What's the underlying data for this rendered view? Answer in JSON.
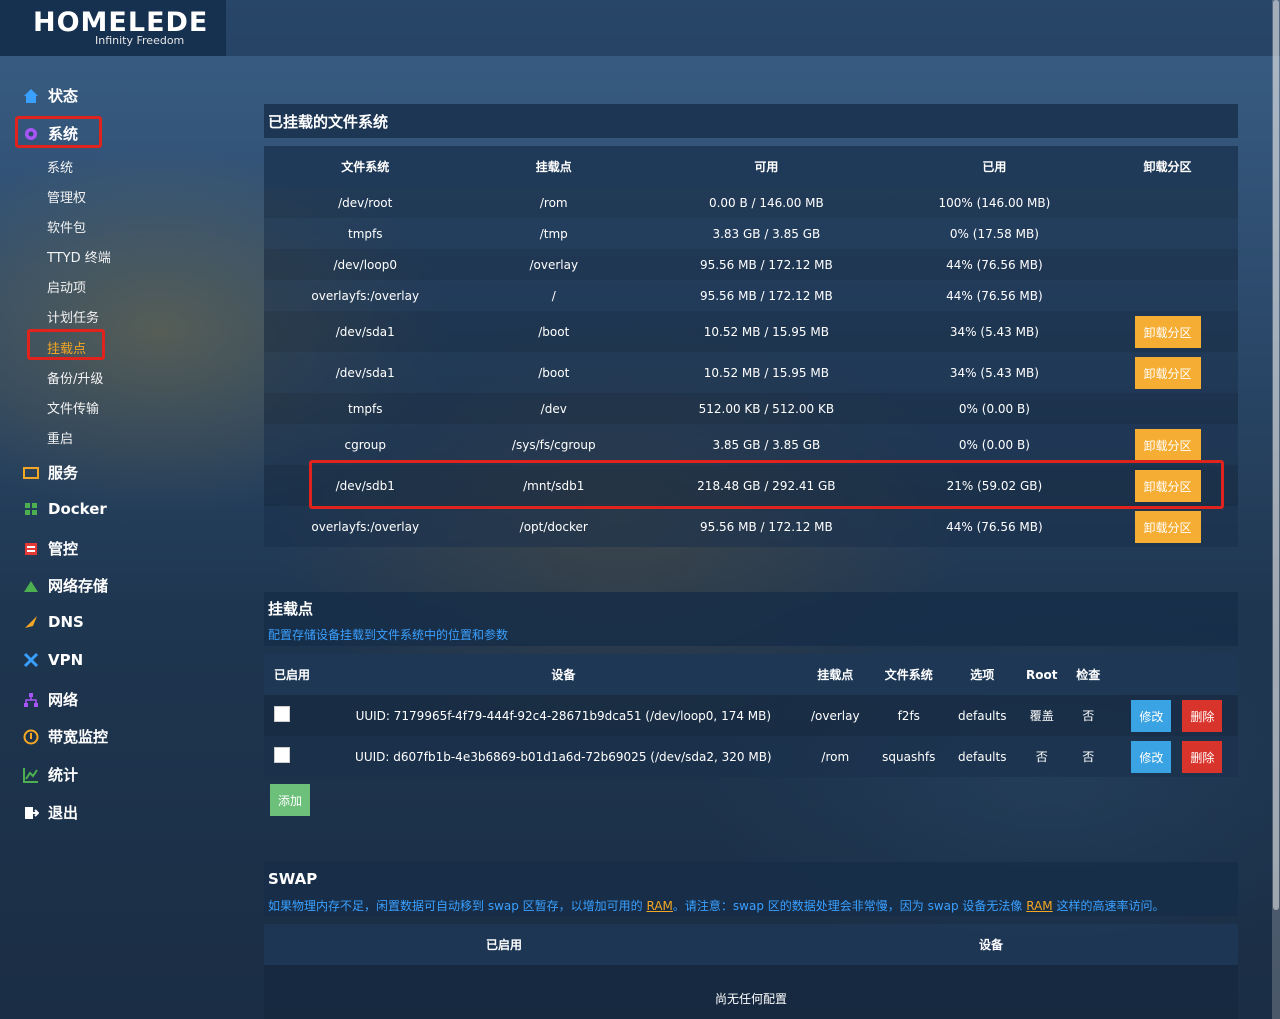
{
  "brand": {
    "name": "HOMELEDE",
    "tagline": "Infinity Freedom"
  },
  "nav": [
    {
      "label": "状态",
      "icon": "home-icon"
    },
    {
      "label": "系统",
      "icon": "gear-icon"
    },
    {
      "label": "服务",
      "icon": "services-icon"
    },
    {
      "label": "Docker",
      "icon": "docker-icon"
    },
    {
      "label": "管控",
      "icon": "control-icon"
    },
    {
      "label": "网络存储",
      "icon": "storage-icon"
    },
    {
      "label": "DNS",
      "icon": "dns-icon"
    },
    {
      "label": "VPN",
      "icon": "vpn-icon"
    },
    {
      "label": "网络",
      "icon": "network-icon"
    },
    {
      "label": "带宽监控",
      "icon": "bandwidth-icon"
    },
    {
      "label": "统计",
      "icon": "stats-icon"
    },
    {
      "label": "退出",
      "icon": "logout-icon"
    }
  ],
  "sub_nav": [
    "系统",
    "管理权",
    "软件包",
    "TTYD 终端",
    "启动项",
    "计划任务",
    "挂载点",
    "备份/升级",
    "文件传输",
    "重启"
  ],
  "mounted": {
    "title": "已挂载的文件系统",
    "headers": [
      "文件系统",
      "挂载点",
      "可用",
      "已用",
      "卸载分区"
    ],
    "rows": [
      {
        "fs": "/dev/root",
        "mount": "/rom",
        "avail": "0.00 B / 146.00 MB",
        "used": "100% (146.00 MB)",
        "action": ""
      },
      {
        "fs": "tmpfs",
        "mount": "/tmp",
        "avail": "3.83 GB / 3.85 GB",
        "used": "0% (17.58 MB)",
        "action": ""
      },
      {
        "fs": "/dev/loop0",
        "mount": "/overlay",
        "avail": "95.56 MB / 172.12 MB",
        "used": "44% (76.56 MB)",
        "action": ""
      },
      {
        "fs": "overlayfs:/overlay",
        "mount": "/",
        "avail": "95.56 MB / 172.12 MB",
        "used": "44% (76.56 MB)",
        "action": ""
      },
      {
        "fs": "/dev/sda1",
        "mount": "/boot",
        "avail": "10.52 MB / 15.95 MB",
        "used": "34% (5.43 MB)",
        "action": "卸载分区"
      },
      {
        "fs": "/dev/sda1",
        "mount": "/boot",
        "avail": "10.52 MB / 15.95 MB",
        "used": "34% (5.43 MB)",
        "action": "卸载分区"
      },
      {
        "fs": "tmpfs",
        "mount": "/dev",
        "avail": "512.00 KB / 512.00 KB",
        "used": "0% (0.00 B)",
        "action": ""
      },
      {
        "fs": "cgroup",
        "mount": "/sys/fs/cgroup",
        "avail": "3.85 GB / 3.85 GB",
        "used": "0% (0.00 B)",
        "action": "卸载分区"
      },
      {
        "fs": "/dev/sdb1",
        "mount": "/mnt/sdb1",
        "avail": "218.48 GB / 292.41 GB",
        "used": "21% (59.02 GB)",
        "action": "卸载分区"
      },
      {
        "fs": "overlayfs:/overlay",
        "mount": "/opt/docker",
        "avail": "95.56 MB / 172.12 MB",
        "used": "44% (76.56 MB)",
        "action": "卸载分区"
      }
    ]
  },
  "mountpoints": {
    "title": "挂载点",
    "desc": "配置存储设备挂载到文件系统中的位置和参数",
    "headers": [
      "已启用",
      "设备",
      "挂载点",
      "文件系统",
      "选项",
      "Root",
      "检查"
    ],
    "rows": [
      {
        "device": "UUID: 7179965f-4f79-444f-92c4-28671b9dca51 (/dev/loop0, 174 MB)",
        "mount": "/overlay",
        "fs": "f2fs",
        "options": "defaults",
        "root": "覆盖",
        "check": "否",
        "edit": "修改",
        "delete": "删除"
      },
      {
        "device": "UUID: d607fb1b-4e3b6869-b01d1a6d-72b69025 (/dev/sda2, 320 MB)",
        "mount": "/rom",
        "fs": "squashfs",
        "options": "defaults",
        "root": "否",
        "check": "否",
        "edit": "修改",
        "delete": "删除"
      }
    ],
    "add_label": "添加"
  },
  "swap": {
    "title": "SWAP",
    "desc_1": "如果物理内存不足，闲置数据可自动移到 swap 区暂存，以增加可用的 ",
    "ram_1": "RAM",
    "desc_2": "。请注意：swap 区的数据处理会非常慢，因为 swap 设备无法像 ",
    "ram_2": "RAM",
    "desc_3": " 这样的高速率访问。",
    "headers": [
      "已启用",
      "设备"
    ],
    "empty": "尚无任何配置"
  }
}
